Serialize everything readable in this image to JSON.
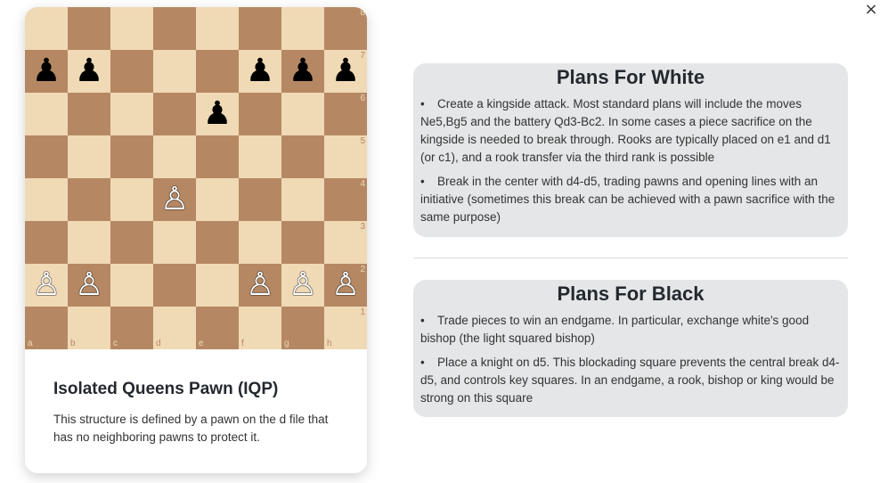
{
  "close_label": "×",
  "board": {
    "files": [
      "a",
      "b",
      "c",
      "d",
      "e",
      "f",
      "g",
      "h"
    ],
    "ranks": [
      "8",
      "7",
      "6",
      "5",
      "4",
      "3",
      "2",
      "1"
    ],
    "pieces": [
      {
        "square": "a7",
        "glyph": "♟",
        "color": "black"
      },
      {
        "square": "b7",
        "glyph": "♟",
        "color": "black"
      },
      {
        "square": "f7",
        "glyph": "♟",
        "color": "black"
      },
      {
        "square": "g7",
        "glyph": "♟",
        "color": "black"
      },
      {
        "square": "h7",
        "glyph": "♟",
        "color": "black"
      },
      {
        "square": "e6",
        "glyph": "♟",
        "color": "black"
      },
      {
        "square": "d4",
        "glyph": "♙",
        "color": "white"
      },
      {
        "square": "a2",
        "glyph": "♙",
        "color": "white"
      },
      {
        "square": "b2",
        "glyph": "♙",
        "color": "white"
      },
      {
        "square": "f2",
        "glyph": "♙",
        "color": "white"
      },
      {
        "square": "g2",
        "glyph": "♙",
        "color": "white"
      },
      {
        "square": "h2",
        "glyph": "♙",
        "color": "white"
      }
    ],
    "light_color": "#f0d9b5",
    "dark_color": "#b58863"
  },
  "structure": {
    "title": "Isolated Queens Pawn (IQP)",
    "description": "This structure is defined by a pawn on the d file that has no neighboring pawns to protect it."
  },
  "white_plans": {
    "title": "Plans For White",
    "items": [
      "Create a kingside attack. Most standard plans will include the moves Ne5,Bg5 and the battery Qd3-Bc2. In some cases a piece sacrifice on the kingside is needed to break through. Rooks are typically placed on e1 and d1 (or c1), and a rook transfer via the third rank is possible",
      "Break in the center with d4-d5, trading pawns and opening lines with an initiative (sometimes this break can be achieved with a pawn sacrifice with the same purpose)"
    ]
  },
  "black_plans": {
    "title": "Plans For Black",
    "items": [
      "Trade pieces to win an endgame. In particular, exchange white's good bishop (the light squared bishop)",
      "Place a knight on d5. This blockading square prevents the central break d4-d5, and controls key squares. In an endgame, a rook, bishop or king would be strong on this square"
    ]
  },
  "bullet": "•"
}
